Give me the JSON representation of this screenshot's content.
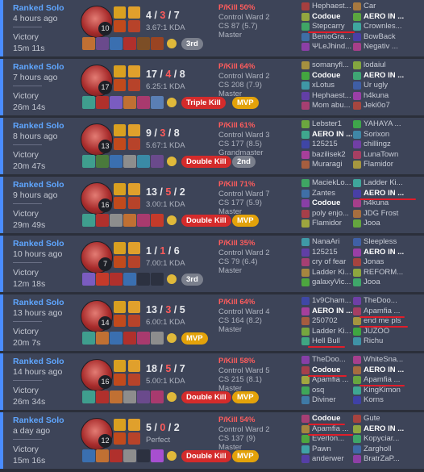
{
  "matches": [
    {
      "queue": "Ranked Solo",
      "ago": "4 hours ago",
      "result": "Victory",
      "duration": "15m 11s",
      "level": "10",
      "kills": "4",
      "deaths": "3",
      "assists": "7",
      "kda_ratio": "3.67:1 KDA",
      "badges": [
        {
          "text": "3rd",
          "type": "place"
        }
      ],
      "pkill": "P/Kill 50%",
      "ward": "Control Ward 2",
      "cs": "CS 87 (5.7)",
      "tier": "Master",
      "blue_team": [
        "Hephaest...",
        "Codoue",
        "Stepcarry",
        "BenioGra...",
        "ΨLeJhind..."
      ],
      "red_team": [
        "Car",
        "AERO IN ...",
        "Crownles...",
        "BowBack",
        "Negativ ..."
      ],
      "items": [
        "#c07033",
        "#6a4a8c",
        "#3a6fb0",
        "#b0302c",
        "#7c4e26",
        "#9a4422"
      ]
    },
    {
      "queue": "Ranked Solo",
      "ago": "7 hours ago",
      "result": "Victory",
      "duration": "26m 14s",
      "level": "17",
      "kills": "17",
      "deaths": "4",
      "assists": "8",
      "kda_ratio": "6.25:1 KDA",
      "badges": [
        {
          "text": "Triple Kill",
          "type": "multi"
        },
        {
          "text": "MVP",
          "type": "mvp"
        }
      ],
      "pkill": "P/Kill 64%",
      "ward": "Control Ward 2",
      "cs": "CS 208 (7.9)",
      "tier": "Master",
      "blue_team": [
        "somanyfl...",
        "Codoue",
        "xLotus",
        "Hephaest...",
        "Mom abu..."
      ],
      "red_team": [
        "lodaiul",
        "AERO IN ...",
        "Ur ugly",
        "h4kuna",
        "Jeki0o7"
      ],
      "items": [
        "#3f9e8e",
        "#b0302c",
        "#7a5cc0",
        "#c07033",
        "#a83a6e",
        "#5a7fb5"
      ]
    },
    {
      "queue": "Ranked Solo",
      "ago": "8 hours ago",
      "result": "Victory",
      "duration": "20m 47s",
      "level": "13",
      "kills": "9",
      "deaths": "3",
      "assists": "8",
      "kda_ratio": "5.67:1 KDA",
      "badges": [
        {
          "text": "Double Kill",
          "type": "multi"
        },
        {
          "text": "2nd",
          "type": "place"
        }
      ],
      "pkill": "P/Kill 61%",
      "ward": "Control Ward 3",
      "cs": "CS 177 (8.5)",
      "tier": "Grandmaster",
      "blue_team": [
        "Lebster1",
        "AERO IN ...",
        "125215",
        "bazilisek2",
        "Muraragi"
      ],
      "red_team": [
        "YAHAYA ...",
        "Sorixon",
        "chillingz",
        "LunaTown",
        "Flamidor"
      ],
      "items": [
        "#3f9e8e",
        "#4a7a3c",
        "#3a6fb0",
        "#8d8d8d",
        "#3a8aa6",
        "#6a4a8c"
      ]
    },
    {
      "queue": "Ranked Solo",
      "ago": "9 hours ago",
      "result": "Victory",
      "duration": "29m 49s",
      "level": "16",
      "kills": "13",
      "deaths": "5",
      "assists": "2",
      "kda_ratio": "3.00:1 KDA",
      "badges": [
        {
          "text": "Double Kill",
          "type": "multi"
        },
        {
          "text": "MVP",
          "type": "mvp"
        }
      ],
      "pkill": "P/Kill 71%",
      "ward": "Control Ward 7",
      "cs": "CS 177 (5.9)",
      "tier": "Master",
      "blue_team": [
        "MaciekLo...",
        "Zantes",
        "Codoue",
        "poly enjo...",
        "Flamidor"
      ],
      "red_team": [
        "Ladder Ki...",
        "AERO IN ...",
        "h4kuna",
        "JDG Frost",
        "Jooa"
      ],
      "items": [
        "#3f9e8e",
        "#b0302c",
        "#8d8d8d",
        "#c07033",
        "#a83a6e",
        "#c43a2a"
      ]
    },
    {
      "queue": "Ranked Solo",
      "ago": "10 hours ago",
      "result": "Victory",
      "duration": "12m 18s",
      "level": "7",
      "kills": "1",
      "deaths": "1",
      "assists": "6",
      "kda_ratio": "7.00:1 KDA",
      "badges": [
        {
          "text": "3rd",
          "type": "place"
        }
      ],
      "pkill": "P/Kill 35%",
      "ward": "Control Ward 2",
      "cs": "CS 79 (6.4)",
      "tier": "Master",
      "blue_team": [
        "NanaAri",
        "125215",
        "cry of fear",
        "Ladder Ki...",
        "galaxyVic..."
      ],
      "red_team": [
        "Sleepless",
        "AERO IN ...",
        "Jonas",
        "REFORM...",
        "Jooa"
      ],
      "items": [
        "#7a5cc0",
        "#c43a2a",
        "#b0302c",
        "#3a6fb0",
        "",
        ""
      ]
    },
    {
      "queue": "Ranked Solo",
      "ago": "13 hours ago",
      "result": "Victory",
      "duration": "20m 7s",
      "level": "14",
      "kills": "13",
      "deaths": "3",
      "assists": "5",
      "kda_ratio": "6.00:1 KDA",
      "badges": [
        {
          "text": "MVP",
          "type": "mvp"
        }
      ],
      "pkill": "P/Kill 64%",
      "ward": "Control Ward 4",
      "cs": "CS 164 (8.2)",
      "tier": "Master",
      "blue_team": [
        "1v9Cham...",
        "AERO IN ...",
        "250702",
        "Ladder Ki...",
        "Hell Bull"
      ],
      "red_team": [
        "TheDoo...",
        "Apamfia ...",
        "end me pls",
        "JUZOO",
        "Richu"
      ],
      "items": [
        "#3f9e8e",
        "#c07033",
        "#3a6fb0",
        "#b0302c",
        "#a83a6e",
        "#8d8d8d"
      ]
    },
    {
      "queue": "Ranked Solo",
      "ago": "14 hours ago",
      "result": "Victory",
      "duration": "26m 34s",
      "level": "16",
      "kills": "18",
      "deaths": "5",
      "assists": "7",
      "kda_ratio": "5.00:1 KDA",
      "badges": [
        {
          "text": "Double Kill",
          "type": "multi"
        },
        {
          "text": "MVP",
          "type": "mvp"
        }
      ],
      "pkill": "P/Kill 58%",
      "ward": "Control Ward 5",
      "cs": "CS 215 (8.1)",
      "tier": "Master",
      "blue_team": [
        "TheDoo...",
        "Codoue",
        "Apamfia ...",
        "osq",
        "Diviner"
      ],
      "red_team": [
        "WhiteSna...",
        "AERO IN ...",
        "Apamfia ...",
        "KingKimon",
        "Korns"
      ],
      "items": [
        "#3f9e8e",
        "#b0302c",
        "#c07033",
        "#8d8d8d",
        "#6a4a8c",
        "#a83a6e"
      ]
    },
    {
      "queue": "Ranked Solo",
      "ago": "a day ago",
      "result": "Victory",
      "duration": "15m 16s",
      "level": "12",
      "kills": "5",
      "deaths": "0",
      "assists": "2",
      "kda_ratio": "Perfect",
      "badges": [
        {
          "text": "Double Kill",
          "type": "multi"
        },
        {
          "text": "MVP",
          "type": "mvp"
        }
      ],
      "pkill": "P/Kill 54%",
      "ward": "Control Ward 2",
      "cs": "CS 137 (9)",
      "tier": "Master",
      "blue_team": [
        "Codoue",
        "Apamfia ...",
        "Everlon...",
        "Pawn",
        "anderwer"
      ],
      "red_team": [
        "Gute",
        "AERO IN ...",
        "Kopyciar...",
        "Zargholl",
        "BratrZaP..."
      ],
      "items": [
        "#3a6fb0",
        "#c07033",
        "#b0302c",
        "#8d8d8d",
        "",
        "#a74fd0"
      ]
    }
  ],
  "colors": {
    "accent": "#4a8cff",
    "card_bg": "#3d4458",
    "page_bg": "#2b2f3a",
    "death": "#ff5b5b",
    "pkill": "#ff5c5c",
    "multikill_badge": "#d42b2b",
    "mvp_badge": "#e3a20a",
    "place_badge": "#7a7f8c",
    "red_markup": "#e01d2a"
  },
  "icons": {
    "champion": "champion-portrait-icon",
    "spell": "summoner-spell-icon",
    "rune": "rune-icon",
    "item": "item-icon",
    "ward": "ward-trinket-icon",
    "player": "player-champion-icon"
  }
}
